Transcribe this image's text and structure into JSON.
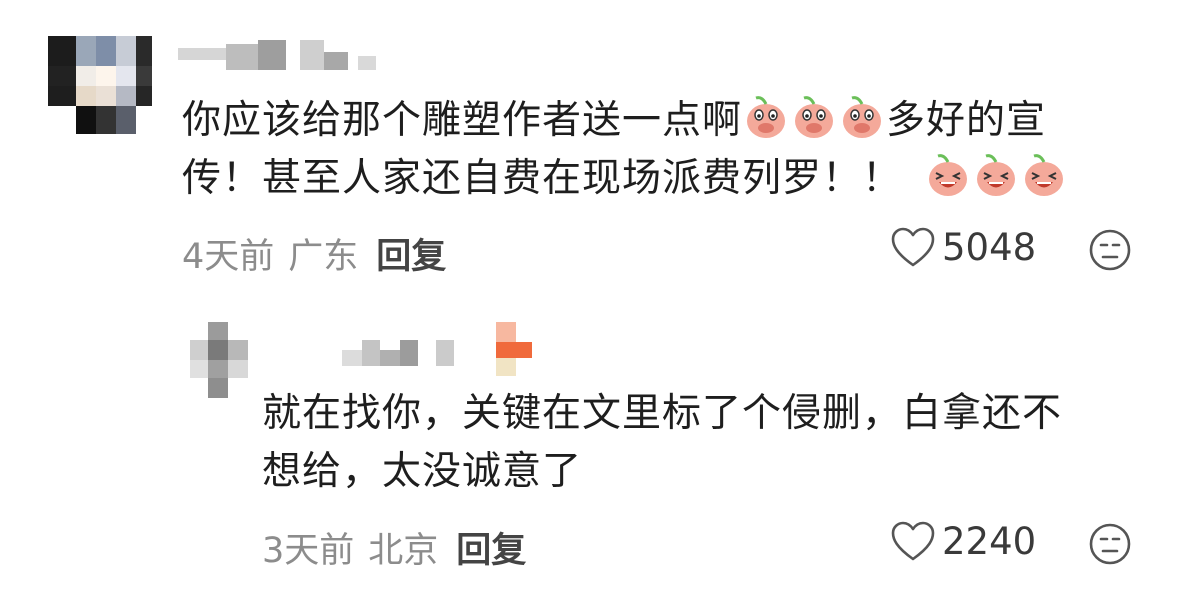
{
  "comments": [
    {
      "text_line1": "你应该给那个雕塑作者送一点啊",
      "text_line1_after": "多好的宣",
      "text_line2": "传！甚至人家还自费在现场派费列罗！！",
      "time": "4天前",
      "location": "广东",
      "reply_label": "回复",
      "likes": "5048",
      "emoji_row1": [
        "peach-cover-mouth",
        "peach-cover-mouth",
        "peach-cover-mouth"
      ],
      "emoji_row2": [
        "peach-laughing",
        "peach-laughing",
        "peach-laughing"
      ]
    },
    {
      "text_line1": "就在找你，关键在文里标了个侵删，白拿还不",
      "text_line2": "想给，太没诚意了",
      "time": "3天前",
      "location": "北京",
      "reply_label": "回复",
      "likes": "2240"
    }
  ],
  "colors": {
    "text": "#1e1e1e",
    "meta": "#8c8c8c",
    "emoji_peach": "#f4a99a",
    "emoji_leaf": "#6bbf59"
  }
}
